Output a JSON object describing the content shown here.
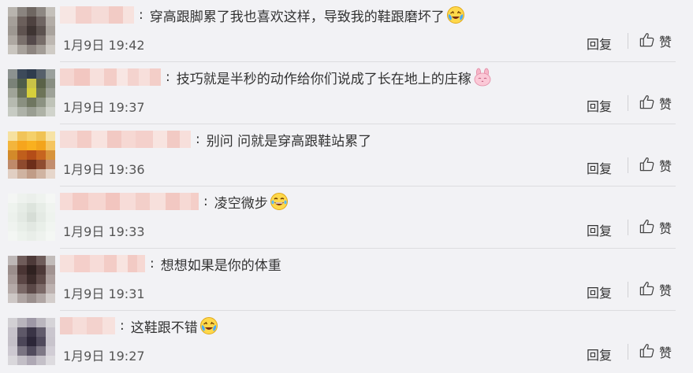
{
  "comments": [
    {
      "colon": ":",
      "text": "穿高跟脚累了我也喜欢这样，导致我的鞋跟磨坏了",
      "emoji": "laughing-crying-emoji",
      "time": "1月9日 19:42",
      "reply_label": "回复",
      "like_label": "赞"
    },
    {
      "colon": ":",
      "text": "技巧就是半秒的动作给你们说成了长在地上的庄稼",
      "emoji": "pink-bunny-emoji",
      "time": "1月9日 19:37",
      "reply_label": "回复",
      "like_label": "赞"
    },
    {
      "colon": ":",
      "text": "别问 问就是穿高跟鞋站累了",
      "emoji": "",
      "time": "1月9日 19:36",
      "reply_label": "回复",
      "like_label": "赞"
    },
    {
      "colon": ":",
      "text": "凌空微步",
      "emoji": "laughing-tears-emoji",
      "time": "1月9日 19:33",
      "reply_label": "回复",
      "like_label": "赞"
    },
    {
      "colon": ":",
      "text": "想想如果是你的体重",
      "emoji": "",
      "time": "1月9日 19:31",
      "reply_label": "回复",
      "like_label": "赞"
    },
    {
      "colon": ":",
      "text": "这鞋跟不错",
      "emoji": "laughing-crying-emoji",
      "time": "1月9日 19:27",
      "reply_label": "回复",
      "like_label": "赞"
    }
  ],
  "colors": {
    "background": "#f2f2f5",
    "text": "#333333",
    "meta": "#555555",
    "divider": "#dcdcdf",
    "blurred_name": "#f2c9c4"
  }
}
